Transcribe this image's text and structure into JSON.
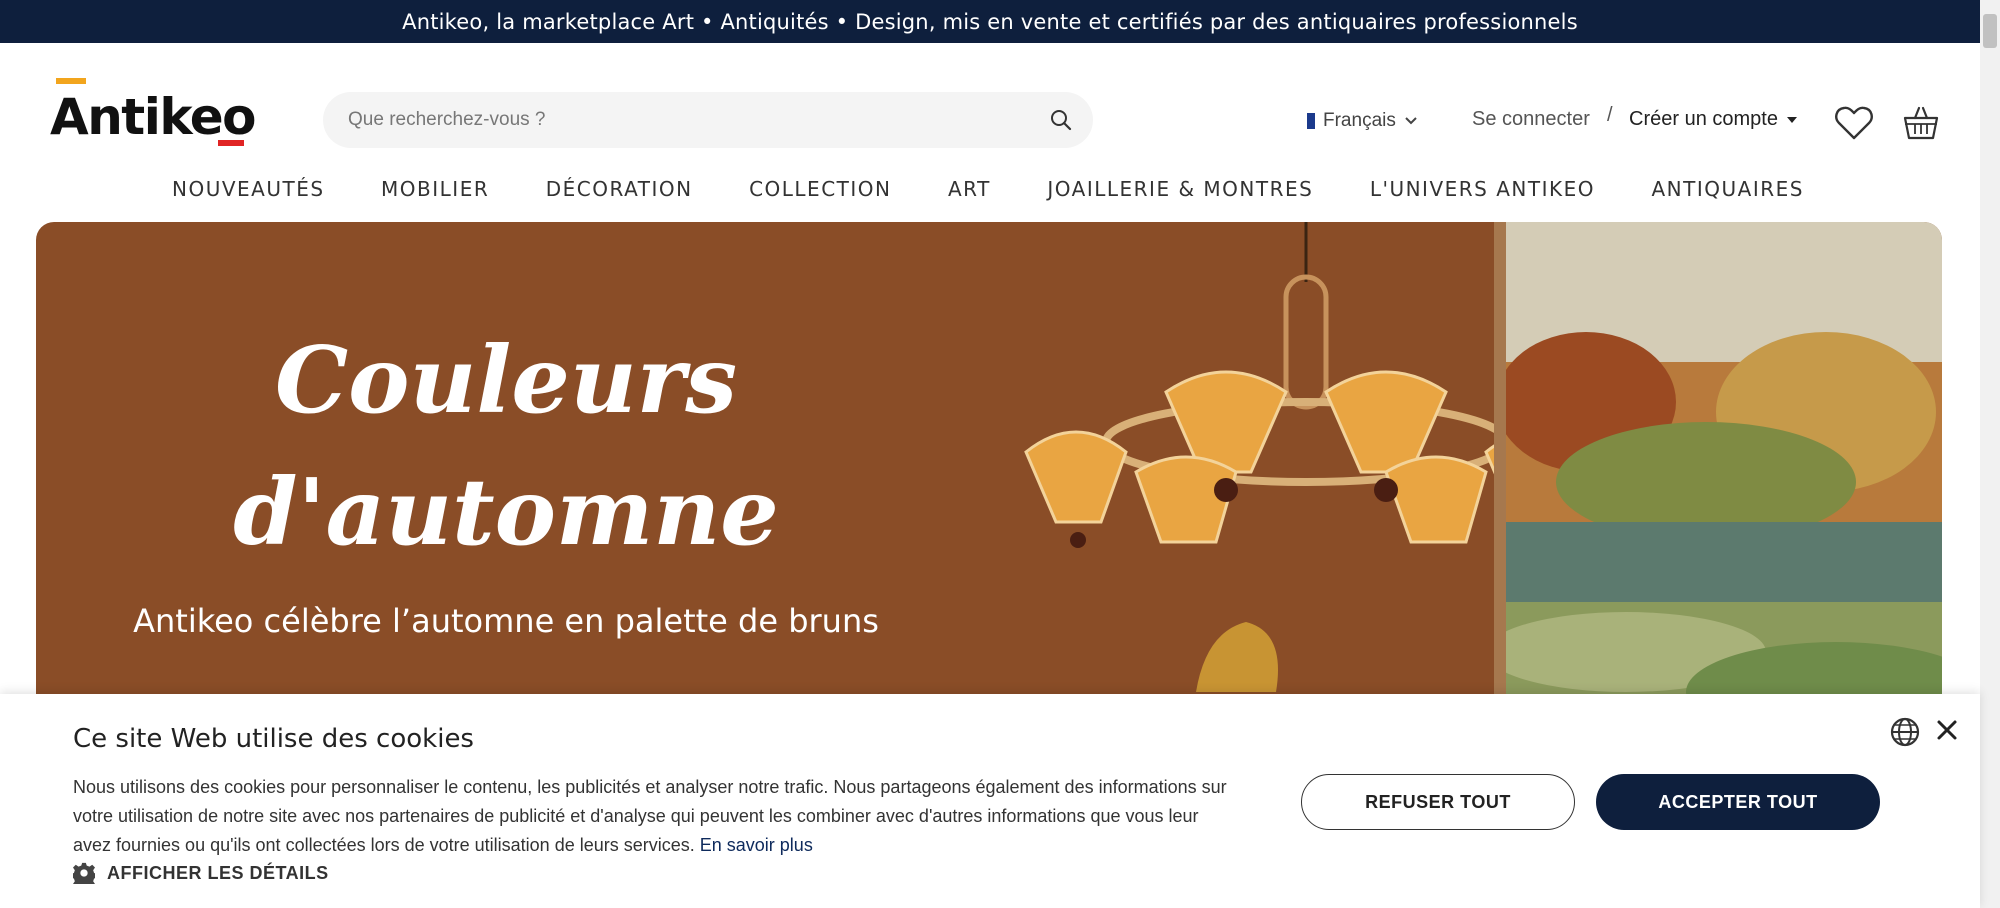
{
  "topbar": {
    "text": "Antikeo, la marketplace Art • Antiquités • Design, mis en vente et certifiés par des antiquaires professionnels"
  },
  "header": {
    "logo_text": "Antikeo",
    "search_placeholder": "Que recherchez-vous ?",
    "language": "Français",
    "login": "Se connecter",
    "separator": "/",
    "signup": "Créer un compte"
  },
  "nav": {
    "items": [
      "NOUVEAUTÉS",
      "MOBILIER",
      "DÉCORATION",
      "COLLECTION",
      "ART",
      "JOAILLERIE & MONTRES",
      "L'UNIVERS ANTIKEO",
      "ANTIQUAIRES"
    ]
  },
  "hero": {
    "title_line1": "Couleurs",
    "title_line2": "d'automne",
    "subtitle": "Antikeo célèbre l’automne en palette de bruns"
  },
  "cookie": {
    "title": "Ce site Web utilise des cookies",
    "text": "Nous utilisons des cookies pour personnaliser le contenu, les publicités et analyser notre trafic. Nous partageons également des informations sur votre utilisation de notre site avec nos partenaires de publicité et d'analyse qui peuvent les combiner avec d'autres informations que vous leur avez fournies ou qu'ils ont collectées lors de votre utilisation de leurs services.",
    "learn_more": "En savoir plus",
    "details": "AFFICHER LES DÉTAILS",
    "refuse": "REFUSER TOUT",
    "accept": "ACCEPTER TOUT"
  },
  "colors": {
    "navy": "#0e1f3d",
    "hero_brown": "#8a4d27",
    "accent_orange": "#f2a51d",
    "accent_red": "#e02424"
  }
}
